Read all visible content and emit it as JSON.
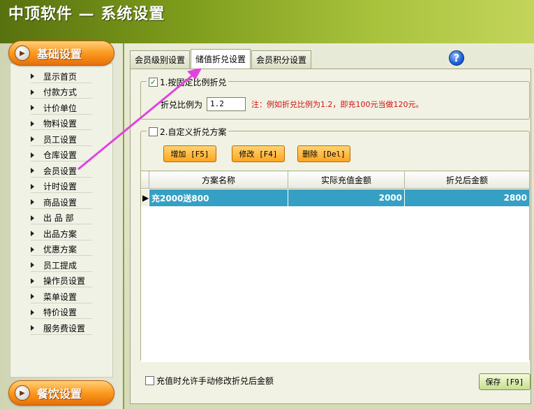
{
  "window": {
    "title": "中顶软件 — 系统设置"
  },
  "sidebar": {
    "section_top": "基础设置",
    "section_bottom": "餐饮设置",
    "items": [
      {
        "label": "显示首页"
      },
      {
        "label": "付款方式"
      },
      {
        "label": "计价单位"
      },
      {
        "label": "物料设置"
      },
      {
        "label": "员工设置"
      },
      {
        "label": "仓库设置"
      },
      {
        "label": "会员设置"
      },
      {
        "label": "计时设置"
      },
      {
        "label": "商品设置"
      },
      {
        "label": "出 品 部"
      },
      {
        "label": "出品方案"
      },
      {
        "label": "优惠方案"
      },
      {
        "label": "员工提成"
      },
      {
        "label": "操作员设置"
      },
      {
        "label": "菜单设置"
      },
      {
        "label": "特价设置"
      },
      {
        "label": "服务费设置"
      }
    ]
  },
  "tabs": [
    {
      "label": "会员级别设置"
    },
    {
      "label": "储值折兑设置"
    },
    {
      "label": "会员积分设置"
    }
  ],
  "help_icon": "?",
  "fixed_ratio": {
    "legend": "1.按固定比例折兑",
    "checked": "✓",
    "ratio_label": "折兑比例为",
    "ratio_value": "1.2",
    "note": "注：例如折兑比例为1.2，即充100元当做120元。"
  },
  "custom_plan": {
    "legend": "2.自定义折兑方案",
    "add_label": "增加 [F5]",
    "edit_label": "修改 [F4]",
    "delete_label": "删除 [Del]",
    "columns": [
      "方案名称",
      "实际充值金额",
      "折兑后金额"
    ],
    "rows": [
      {
        "name": "充2000送800",
        "actual": "2000",
        "after": "2800"
      }
    ]
  },
  "bottom": {
    "allow_manual_label": "充值时允许手动修改折兑后金额",
    "save_label": "保存 [F9]"
  },
  "colors": {
    "accent_orange": "#fb9a1e",
    "header_green": "#7e9c1c",
    "selected_row": "#36a0c4",
    "annotation_arrow": "#e044e0",
    "note_red": "#d01010"
  }
}
